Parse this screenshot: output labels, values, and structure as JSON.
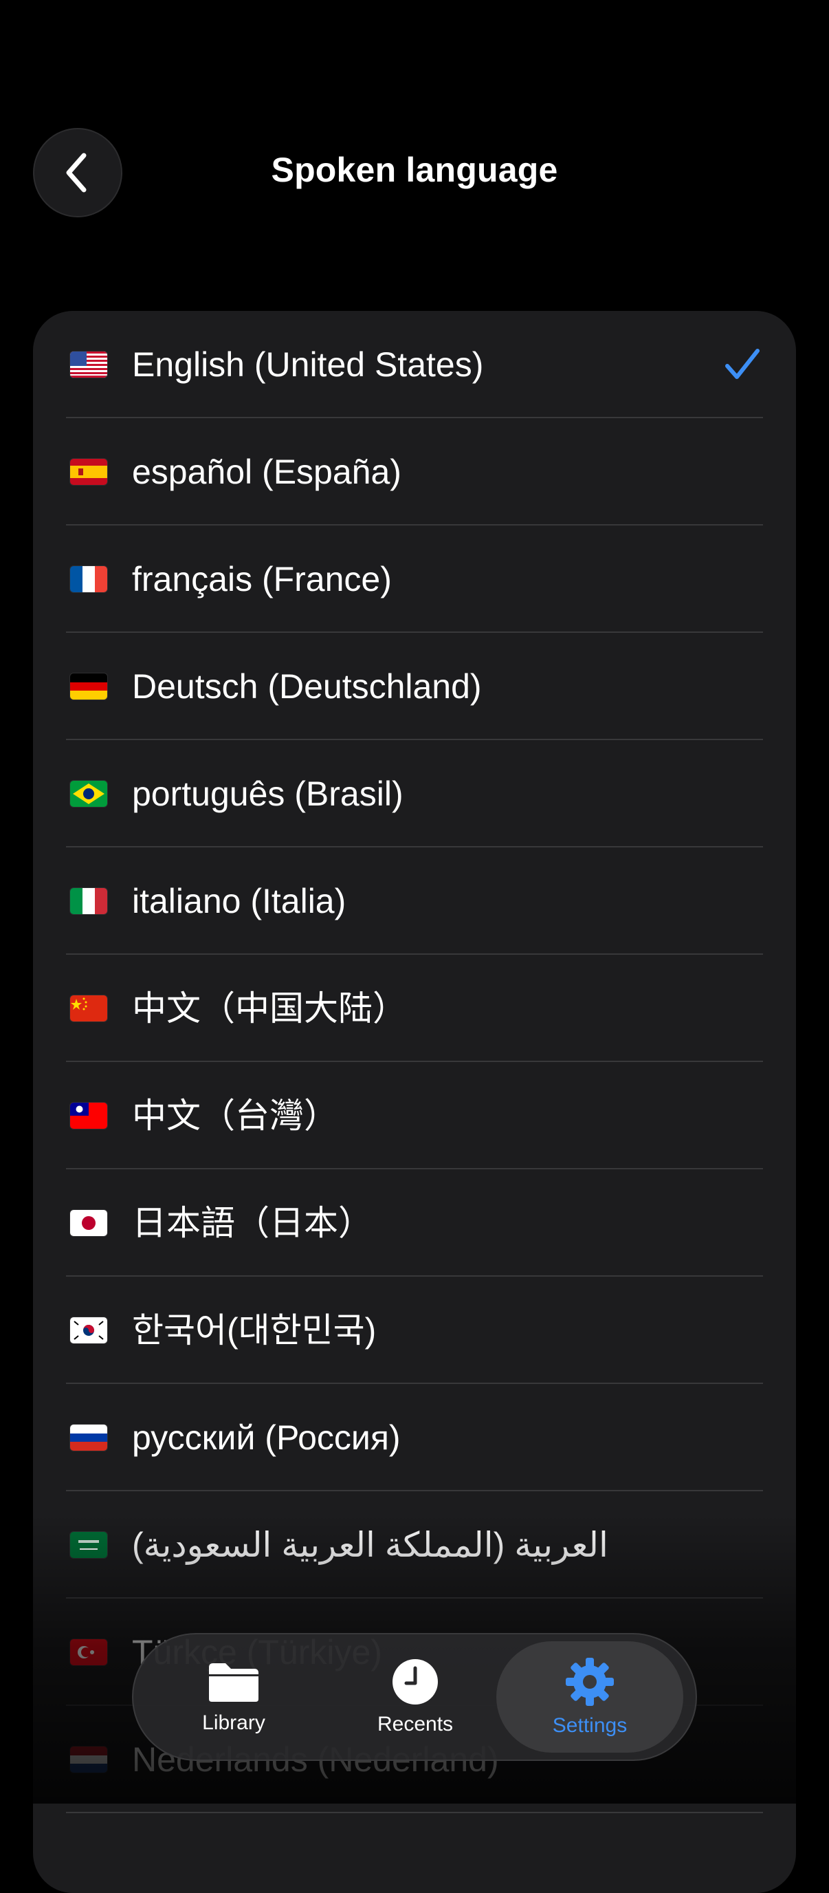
{
  "header": {
    "title": "Spoken language"
  },
  "languages": [
    {
      "label": "English (United States)",
      "flag": "us-flag",
      "selected": true
    },
    {
      "label": "español (España)",
      "flag": "es-flag"
    },
    {
      "label": "français (France)",
      "flag": "fr-flag"
    },
    {
      "label": "Deutsch (Deutschland)",
      "flag": "de-flag"
    },
    {
      "label": "português (Brasil)",
      "flag": "br-flag"
    },
    {
      "label": "italiano (Italia)",
      "flag": "it-flag"
    },
    {
      "label": "中文（中国大陆）",
      "flag": "cn-flag"
    },
    {
      "label": "中文（台灣）",
      "flag": "tw-flag"
    },
    {
      "label": "日本語（日本）",
      "flag": "jp-flag"
    },
    {
      "label": "한국어(대한민국)",
      "flag": "kr-flag"
    },
    {
      "label": "русский (Россия)",
      "flag": "ru-flag"
    },
    {
      "label": "العربية (المملكة العربية السعودية)",
      "flag": "sa-flag"
    },
    {
      "label": "Türkçe (Türkiye)",
      "flag": "tr-flag"
    },
    {
      "label": "Nederlands (Nederland)",
      "flag": "nl-flag"
    }
  ],
  "tabbar": {
    "library": "Library",
    "recents": "Recents",
    "settings": "Settings"
  },
  "colors": {
    "accent": "#3d8ff5",
    "card": "#1c1c1e",
    "separator": "#38383a"
  }
}
